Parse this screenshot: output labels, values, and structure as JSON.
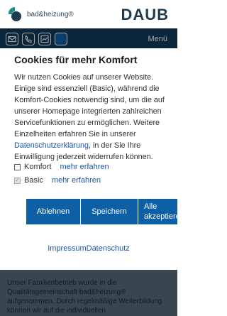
{
  "header": {
    "logo_text": "bad&heizung®",
    "brand": "DAUB"
  },
  "nav": {
    "menu_label": "Menü",
    "icons": [
      "mail-icon",
      "phone-icon",
      "chart-icon",
      "action-icon"
    ]
  },
  "cookie_dialog": {
    "title": "Cookies für mehr Komfort",
    "body_before_link": "Wir nutzen Cookies auf unserer Website. Einige sind essenziell (Basic), während die Komfort-Cookies notwendig sind, um die auf unserer Homepage integrierten zahlreichen Servicefunktionen zu ermöglichen. Weitere Einzelheiten erfahren Sie in unserer ",
    "privacy_link": "Datenschutzerklärung",
    "body_after_link": ", in der Sie Ihre Einwilligung jederzeit widerrufen können.",
    "options": [
      {
        "label": "Komfort",
        "more": "mehr erfahren",
        "checked": false
      },
      {
        "label": "Basic",
        "more": "mehr erfahren",
        "checked": true
      }
    ],
    "buttons": {
      "decline": "Ablehnen",
      "save": "Speichern",
      "accept_all": "Alle akzeptieren"
    },
    "footer": {
      "imprint": "Impressum",
      "privacy": "Datenschutz"
    }
  },
  "page_text": "Unser Familienbetrieb wurde in die Qualitätsgemeinschaft bad&heizung® aufgenommen. Durch regelmäßige Weiterbildung können wir auf die individuellen",
  "colors": {
    "nav_background": "#11395a",
    "button_background": "#0d5fa6",
    "link": "#1a56a6"
  }
}
